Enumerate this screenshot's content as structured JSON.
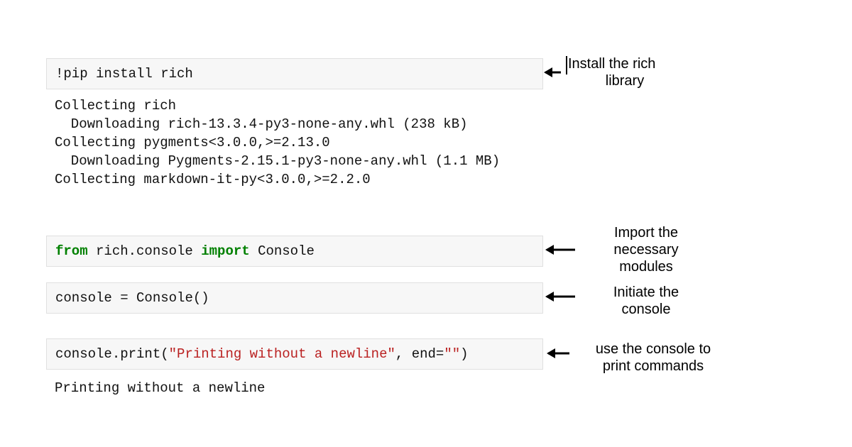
{
  "cells": [
    {
      "type": "code",
      "segments": [
        {
          "text": "!pip install rich",
          "cls": "tok-plain"
        }
      ]
    },
    {
      "type": "output",
      "lines": [
        "Collecting rich",
        "  Downloading rich-13.3.4-py3-none-any.whl (238 kB)",
        "Collecting pygments<3.0.0,>=2.13.0",
        "  Downloading Pygments-2.15.1-py3-none-any.whl (1.1 MB)",
        "Collecting markdown-it-py<3.0.0,>=2.2.0"
      ]
    },
    {
      "type": "code",
      "segments": [
        {
          "text": "from",
          "cls": "tok-kw"
        },
        {
          "text": " rich.console ",
          "cls": "tok-plain"
        },
        {
          "text": "import",
          "cls": "tok-kw"
        },
        {
          "text": " Console",
          "cls": "tok-plain"
        }
      ]
    },
    {
      "type": "code",
      "segments": [
        {
          "text": "console ",
          "cls": "tok-plain"
        },
        {
          "text": "=",
          "cls": "tok-plain"
        },
        {
          "text": " Console()",
          "cls": "tok-plain"
        }
      ]
    },
    {
      "type": "code",
      "segments": [
        {
          "text": "console.",
          "cls": "tok-plain"
        },
        {
          "text": "print",
          "cls": "tok-plain"
        },
        {
          "text": "(",
          "cls": "tok-plain"
        },
        {
          "text": "\"Printing without a newline\"",
          "cls": "tok-str"
        },
        {
          "text": ", end",
          "cls": "tok-plain"
        },
        {
          "text": "=",
          "cls": "tok-plain"
        },
        {
          "text": "\"\"",
          "cls": "tok-str"
        },
        {
          "text": ")",
          "cls": "tok-plain"
        }
      ]
    },
    {
      "type": "output",
      "lines": [
        "Printing without a newline"
      ]
    }
  ],
  "annotations": {
    "a1_line1": "Install the rich",
    "a1_line2": "library",
    "a2_line1": "Import the",
    "a2_line2": "necessary",
    "a2_line3": "modules",
    "a3_line1": "Initiate the",
    "a3_line2": "console",
    "a4_line1": "use the console to",
    "a4_line2": "print commands"
  }
}
